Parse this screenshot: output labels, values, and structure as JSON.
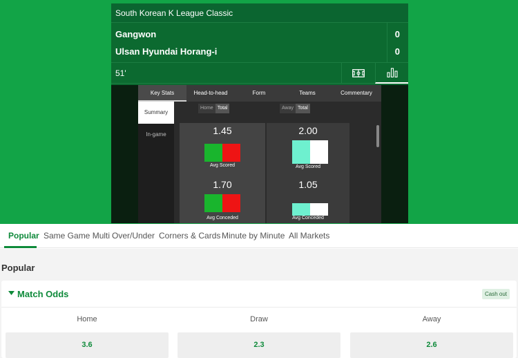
{
  "scoreboard": {
    "league": "South Korean K League Classic",
    "home_team": "Gangwon",
    "away_team": "Ulsan Hyundai Horang-i",
    "home_score": "0",
    "away_score": "0",
    "match_time": "51'",
    "pitch_icon": "pitch-icon",
    "stats_icon": "bar-chart-icon"
  },
  "stats_widget": {
    "tabs": [
      "Key Stats",
      "Head-to-head",
      "Form",
      "Teams",
      "Commentary"
    ],
    "active_tab": "Key Stats",
    "side_items": [
      "Summary",
      "In-game"
    ],
    "active_side": "Summary",
    "home_toggle": [
      "Home",
      "Total"
    ],
    "away_toggle": [
      "Away",
      "Total"
    ],
    "home": {
      "avg_scored": "1.45",
      "avg_scored_label": "Avg Scored",
      "avg_conceded": "1.70",
      "avg_conceded_label": "Avg Conceded",
      "colors": [
        "#19b52d",
        "#ee1414"
      ]
    },
    "away": {
      "avg_scored": "2.00",
      "avg_scored_label": "Avg Scored",
      "avg_conceded": "1.05",
      "avg_conceded_label": "Avg Conceded",
      "colors": [
        "#6ef0cf",
        "#ffffff"
      ]
    }
  },
  "market_tabs": [
    "Popular",
    "Same Game Multi",
    "Over/Under",
    "Corners & Cards",
    "Minute by Minute",
    "All Markets"
  ],
  "active_market_tab": "Popular",
  "section_title": "Popular",
  "match_odds": {
    "title": "Match Odds",
    "cash_out": "Cash out",
    "columns": [
      "Home",
      "Draw",
      "Away"
    ],
    "odds": [
      "3.6",
      "2.3",
      "2.6"
    ]
  },
  "colors": {
    "brand_green": "#12a447",
    "dark_green": "#0c6a30",
    "accent_text_green": "#0e8a3a"
  }
}
